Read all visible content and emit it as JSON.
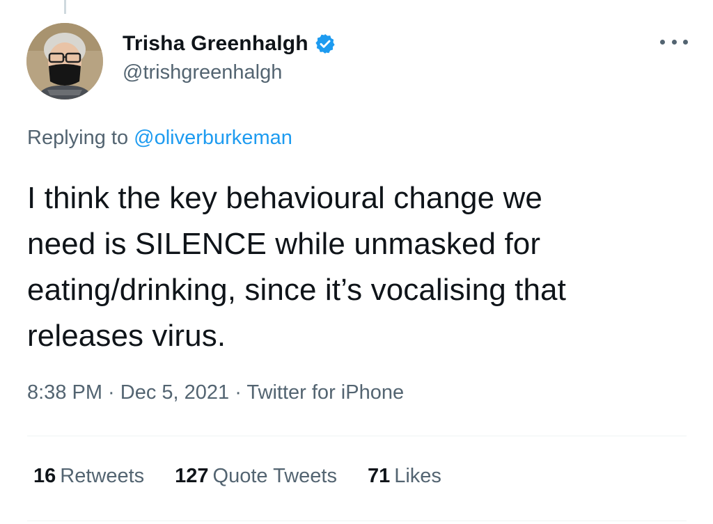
{
  "author": {
    "display_name": "Trisha Greenhalgh",
    "handle": "@trishgreenhalgh",
    "verified": true
  },
  "reply": {
    "prefix": "Replying to",
    "mention": "@oliverburkeman"
  },
  "tweet": {
    "lines": [
      "I think the key behavioural change we",
      "need is SILENCE while unmasked for",
      "eating/drinking, since it’s vocalising that",
      "releases virus."
    ]
  },
  "meta": {
    "time": "8:38 PM",
    "date": "Dec 5, 2021",
    "source": "Twitter for iPhone",
    "separator": " · "
  },
  "stats": {
    "retweets_count": "16",
    "retweets_label": "Retweets",
    "quotes_count": "127",
    "quotes_label": "Quote Tweets",
    "likes_count": "71",
    "likes_label": "Likes"
  },
  "colors": {
    "text_primary": "#0f1419",
    "text_secondary": "#536471",
    "accent": "#1d9bf0",
    "divider": "#eff3f4"
  },
  "icons": {
    "verified": "verified-badge-icon",
    "more": "more-horizontal-icon"
  }
}
